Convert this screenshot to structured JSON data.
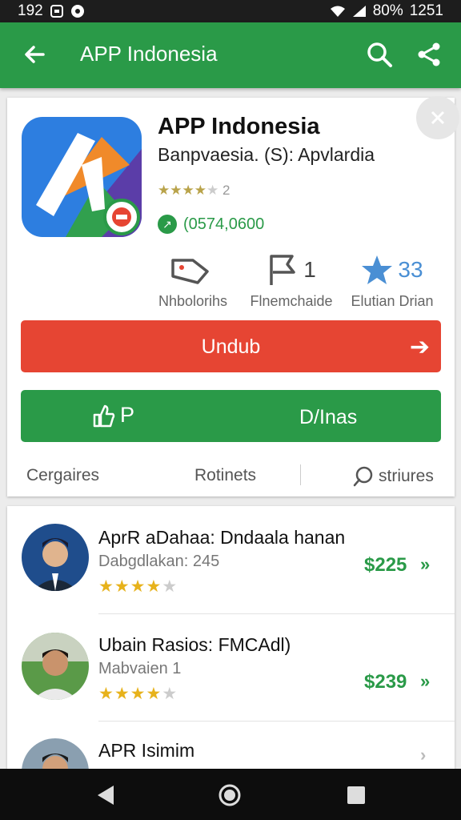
{
  "status_bar": {
    "left_time": "192",
    "left_icons": [
      "lock-icon",
      "record-icon"
    ],
    "battery": "80%",
    "time": "1251"
  },
  "app_bar": {
    "title": "APP Indonesia"
  },
  "app": {
    "name": "APP Indonesia",
    "developer": "Banpvaesia. (S): Apvlardia",
    "rating_count": "2",
    "installs": "(0574,0600",
    "stats": [
      {
        "icon": "tag-icon",
        "value": "",
        "label": "Nhbolorihs"
      },
      {
        "icon": "flag-icon",
        "value": "1",
        "label": "Flnemchaide"
      },
      {
        "icon": "star-icon",
        "value": "33",
        "label": "Elutian Drian"
      }
    ],
    "download_label": "Undub",
    "second_btn_left": "P",
    "second_btn_label": "D/Inas",
    "tabs": [
      "Cergaires",
      "Rotinets",
      "striures"
    ]
  },
  "listings": [
    {
      "name": "AprR aDahaa: Dndaala hanan",
      "sub": "Dabgdlakan: 245",
      "rating": 3.5,
      "price": "$225"
    },
    {
      "name": "Ubain Rasios: FMCAdl)",
      "sub": "Mabvaien 1",
      "rating": 3.5,
      "price": "$239"
    },
    {
      "name": "APR Isimim",
      "sub": "",
      "rating": 0,
      "price": ""
    }
  ],
  "colors": {
    "primary_green": "#2a9a48",
    "download_red": "#e64533",
    "star_gold": "#e7b21b"
  }
}
